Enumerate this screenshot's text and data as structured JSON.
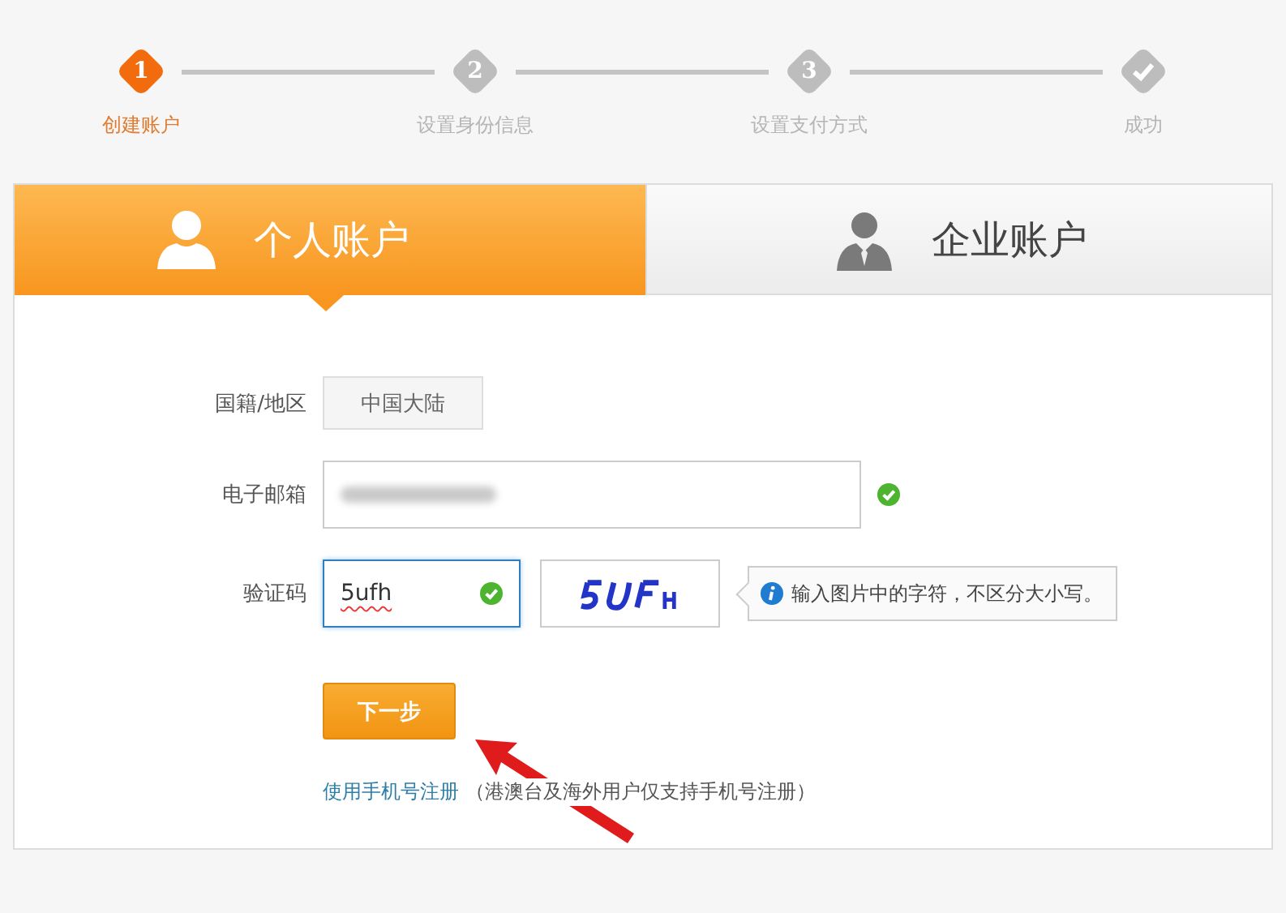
{
  "steps": [
    {
      "number": "1",
      "label": "创建账户",
      "selected": true
    },
    {
      "number": "2",
      "label": "设置身份信息",
      "selected": false
    },
    {
      "number": "3",
      "label": "设置支付方式",
      "selected": false
    },
    {
      "label": "成功",
      "selected": false,
      "kind": "check"
    }
  ],
  "account_tabs": [
    {
      "label": "个人账户",
      "selected": true,
      "kind": "personal"
    },
    {
      "label": "企业账户",
      "selected": false,
      "kind": "business"
    }
  ],
  "form": {
    "fields": [
      {
        "label": "国籍/地区",
        "kind": "select",
        "value": "中国大陆"
      },
      {
        "label": "电子邮箱",
        "kind": "email",
        "valid": true
      },
      {
        "label": "验证码",
        "kind": "captcha",
        "value": "5ufh",
        "valid": true,
        "focused": true,
        "hint": "输入图片中的字符，不区分大小写。"
      }
    ],
    "submit": "下一步",
    "alt_link": "使用手机号注册",
    "alt_note": "（港澳台及海外用户仅支持手机号注册）"
  }
}
